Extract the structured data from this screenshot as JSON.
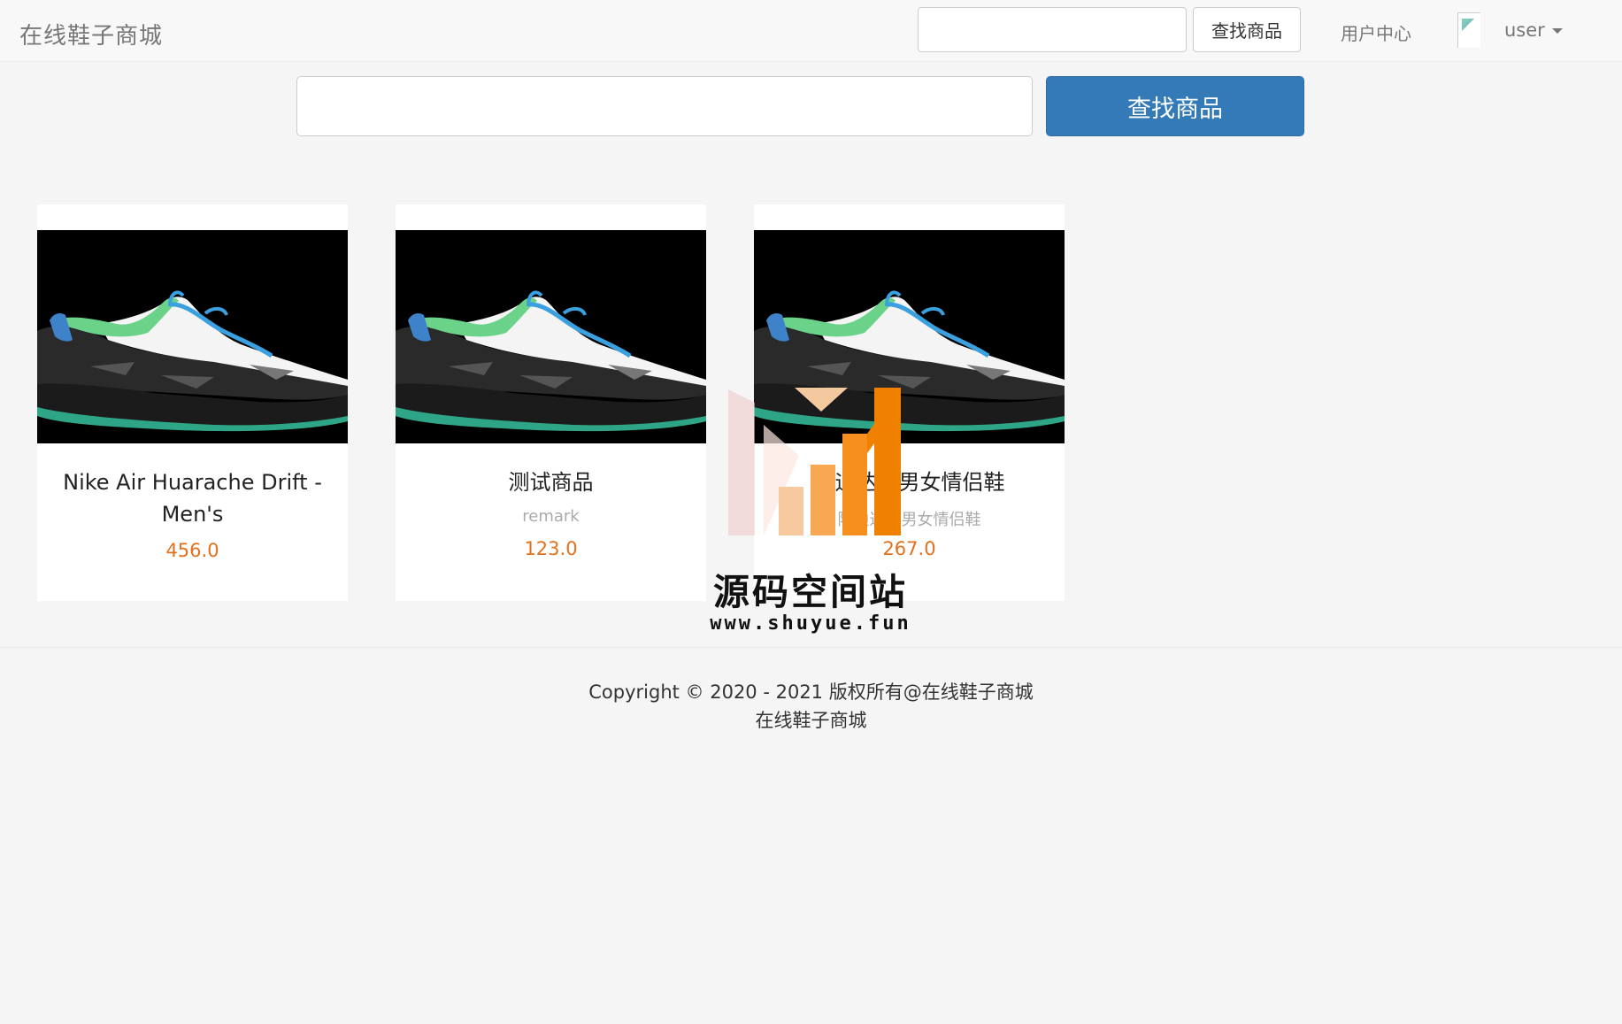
{
  "navbar": {
    "brand": "在线鞋子商城",
    "search_placeholder": "",
    "search_button": "查找商品",
    "user_center": "用户中心",
    "user_name": "user"
  },
  "main_search": {
    "placeholder": "",
    "button": "查找商品"
  },
  "products": [
    {
      "name": "Nike Air Huarache Drift - Men's",
      "remark": "",
      "price": "456.0"
    },
    {
      "name": "测试商品",
      "remark": "remark",
      "price": "123.0"
    },
    {
      "name": "阿迪达斯男女情侣鞋",
      "remark": "阿迪达斯男女情侣鞋",
      "price": "267.0"
    }
  ],
  "watermark": {
    "title": "源码空间站",
    "url": "www.shuyue.fun"
  },
  "footer": {
    "copyright": "Copyright © 2020 - 2021 版权所有@在线鞋子商城",
    "name": "在线鞋子商城"
  },
  "colors": {
    "primary": "#337ab7",
    "price": "#e2711d",
    "shoe_accent": "#3aa0e0",
    "shoe_green": "#5fd17a"
  }
}
